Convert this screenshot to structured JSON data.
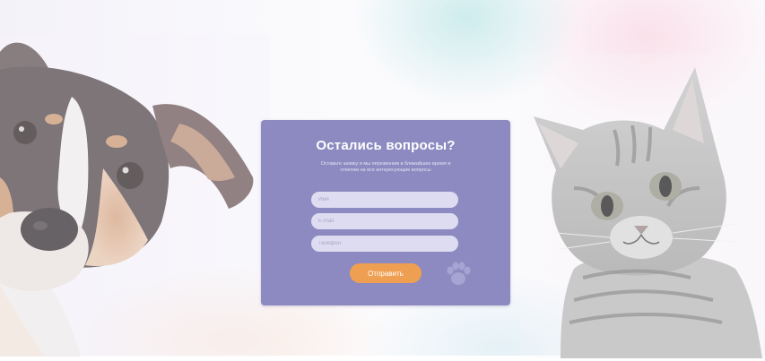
{
  "form": {
    "title": "Остались вопросы?",
    "subtitle": "Оставьте заявку и мы перезвоним в ближайшее время и ответим на все интересующие вопросы",
    "name_placeholder": "Имя",
    "email_placeholder": "E-mail",
    "phone_placeholder": "Телефон",
    "submit_label": "Отправить"
  },
  "images": {
    "left": "dog-photo",
    "right": "cat-photo",
    "decoration": "paw-icon"
  },
  "colors": {
    "card": "#8c8ac0",
    "button": "#ef9f52",
    "field": "#dedcf1"
  }
}
